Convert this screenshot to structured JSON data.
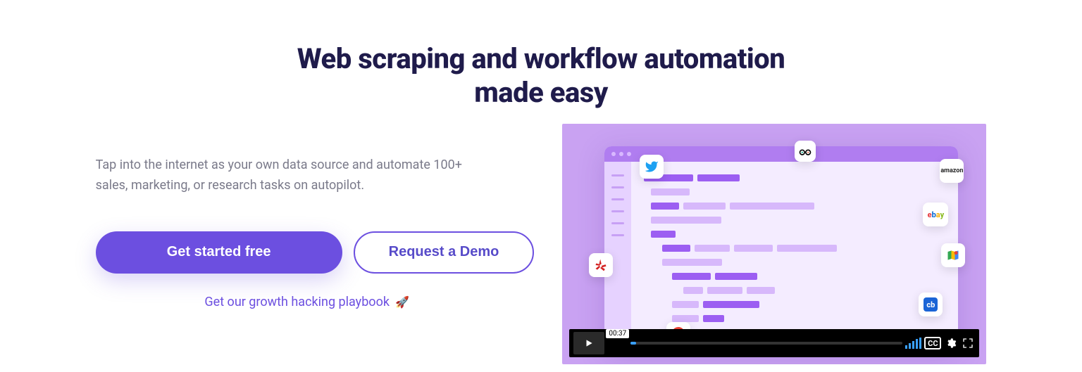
{
  "headline_line1": "Web scraping and workflow automation",
  "headline_line2": "made easy",
  "description": "Tap into the internet as your own data source and automate 100+ sales, marketing, or research tasks on autopilot.",
  "cta": {
    "primary": "Get started free",
    "secondary": "Request a Demo"
  },
  "playbook": {
    "text": "Get our growth hacking playbook",
    "emoji": "🚀"
  },
  "video": {
    "time": "00:37",
    "cc_label": "CC"
  },
  "tiles": {
    "amazon": "amazon"
  }
}
